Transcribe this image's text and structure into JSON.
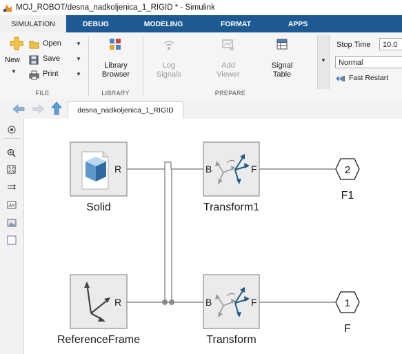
{
  "window": {
    "title": "MOJ_ROBOT/desna_nadkoljenica_1_RIGID * - Simulink"
  },
  "tabs": [
    {
      "label": "SIMULATION",
      "active": true
    },
    {
      "label": "DEBUG",
      "active": false
    },
    {
      "label": "MODELING",
      "active": false
    },
    {
      "label": "FORMAT",
      "active": false
    },
    {
      "label": "APPS",
      "active": false
    }
  ],
  "ribbon": {
    "file": {
      "group_label": "FILE",
      "new_label": "New",
      "open_label": "Open",
      "save_label": "Save",
      "print_label": "Print"
    },
    "library": {
      "group_label": "LIBRARY",
      "browser_label_1": "Library",
      "browser_label_2": "Browser"
    },
    "prepare": {
      "group_label": "PREPARE",
      "log_label_1": "Log",
      "log_label_2": "Signals",
      "viewer_label_1": "Add",
      "viewer_label_2": "Viewer",
      "table_label_1": "Signal",
      "table_label_2": "Table"
    },
    "simulate": {
      "stop_time_label": "Stop Time",
      "stop_time_value": "10.0",
      "mode_value": "Normal",
      "fast_restart_label": "Fast Restart"
    }
  },
  "breadcrumb": {
    "label": "desna_nadkoljenica_1_RIGID"
  },
  "diagram": {
    "blocks": {
      "solid": {
        "label": "Solid",
        "port": "R"
      },
      "reference_frame": {
        "label": "ReferenceFrame",
        "port": "R"
      },
      "transform1": {
        "label": "Transform1",
        "port_in": "B",
        "port_out": "F"
      },
      "transform": {
        "label": "Transform",
        "port_in": "B",
        "port_out": "F"
      },
      "outport_2": {
        "number": "2",
        "label": "F1"
      },
      "outport_1": {
        "number": "1",
        "label": "F"
      }
    }
  },
  "colors": {
    "tab_bar": "#1d5a94",
    "block_border": "#8c8c8c",
    "connection_line": "#8a8a8a",
    "frame_arrow_blue": "#1e5a8a"
  }
}
